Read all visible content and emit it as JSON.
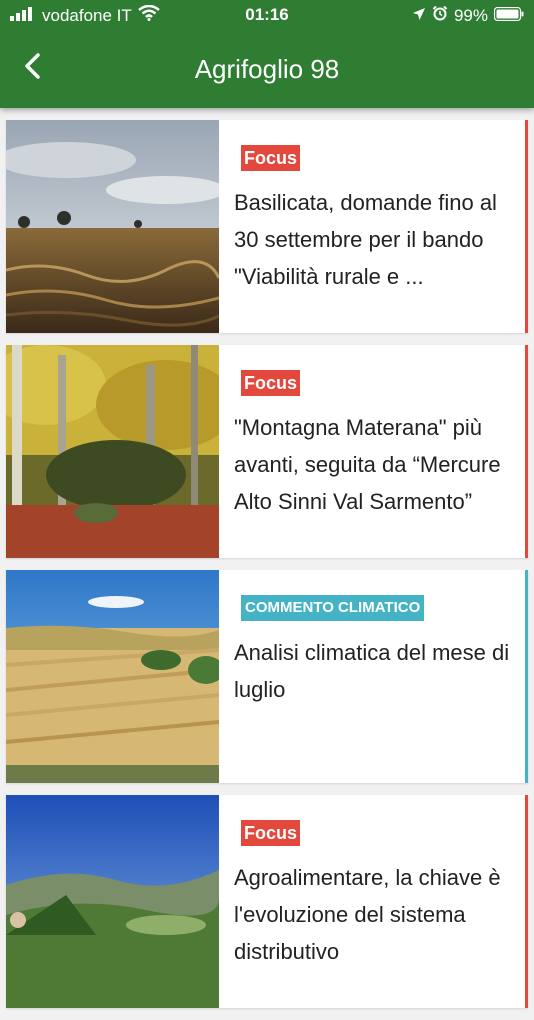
{
  "status_bar": {
    "carrier": "vodafone IT",
    "time": "01:16",
    "battery": "99%"
  },
  "nav": {
    "title": "Agrifoglio 98"
  },
  "colors": {
    "header_green": "#2f7d33",
    "focus_red": "#e2483b",
    "climate_teal": "#45b3c6"
  },
  "articles": [
    {
      "badge": "Focus",
      "badge_type": "focus",
      "title": "Basilicata, domande fino al 30 settembre per il bando \"Viabilità rurale e ..."
    },
    {
      "badge": "Focus",
      "badge_type": "focus",
      "title": "\"Montagna Materana\" più avanti, seguita da “Mercure Alto Sinni Val Sarmento”"
    },
    {
      "badge": "COMMENTO CLIMATICO",
      "badge_type": "climate",
      "title": "Analisi climatica del mese di luglio"
    },
    {
      "badge": "Focus",
      "badge_type": "focus",
      "title": "Agroalimentare, la chiave è l'evoluzione del sistema distributivo"
    }
  ]
}
